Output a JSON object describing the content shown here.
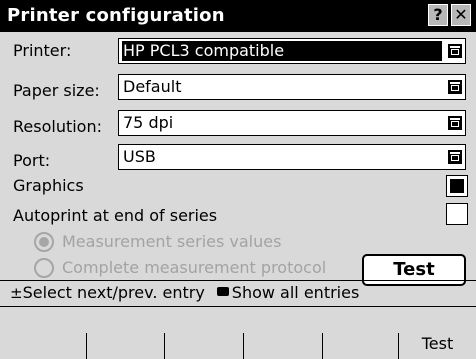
{
  "window": {
    "title": "Printer configuration",
    "help_label": "?",
    "close_label": "✕"
  },
  "form": {
    "printer": {
      "label": "Printer:",
      "value": "HP PCL3 compatible"
    },
    "paper_size": {
      "label": "Paper size:",
      "value": "Default"
    },
    "resolution": {
      "label": "Resolution:",
      "value": "75 dpi"
    },
    "port": {
      "label": "Port:",
      "value": "USB"
    },
    "graphics": {
      "label": "Graphics",
      "checked": true
    },
    "autoprint": {
      "label": "Autoprint at end of series",
      "checked": false
    },
    "radio_measurement": {
      "label": "Measurement series values",
      "selected": true
    },
    "radio_complete": {
      "label": "Complete measurement protocol",
      "selected": false
    },
    "test_button": "Test"
  },
  "status_bar": {
    "select_symbol": "±",
    "select_text": "Select next/prev. entry",
    "show_text": "Show all entries"
  },
  "softkeys": [
    "",
    "",
    "",
    "",
    "",
    "Test"
  ],
  "colors": {
    "titlebar": "#000000",
    "background": "#d9d9d9",
    "disabled_text": "#a3a3a3"
  }
}
